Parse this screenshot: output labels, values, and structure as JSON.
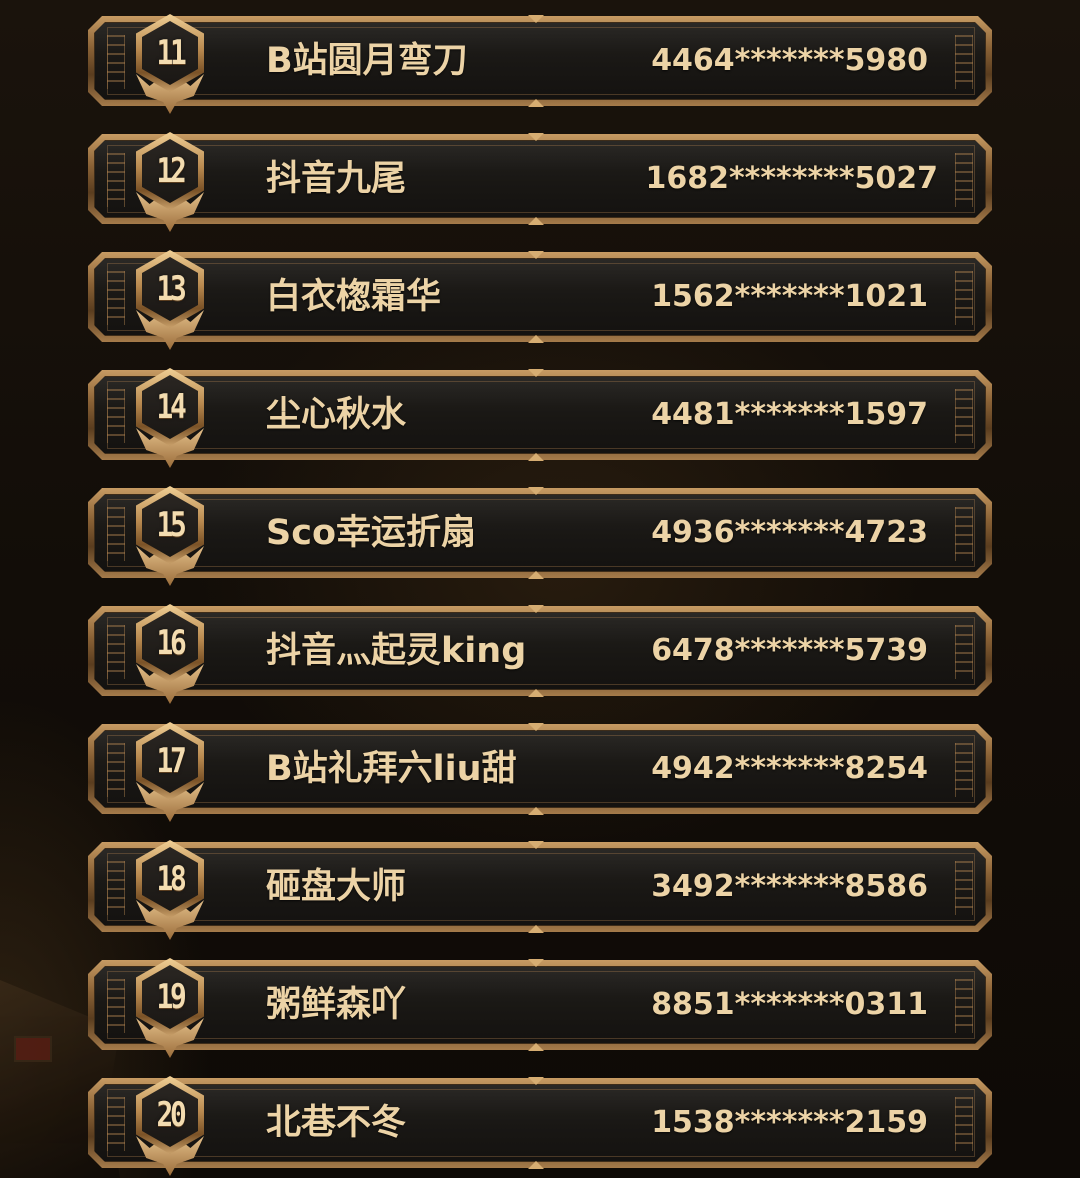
{
  "entries": [
    {
      "rank": "11",
      "name": "B站圆月弯刀",
      "account": "4464*******5980"
    },
    {
      "rank": "12",
      "name": "抖音九尾",
      "account": "1682********5027"
    },
    {
      "rank": "13",
      "name": "白衣楤霜华",
      "account": "1562*******1021"
    },
    {
      "rank": "14",
      "name": "尘心秋水",
      "account": "4481*******1597"
    },
    {
      "rank": "15",
      "name": "Sco幸运折扇",
      "account": "4936*******4723"
    },
    {
      "rank": "16",
      "name": "抖音灬起灵king",
      "account": "6478*******5739"
    },
    {
      "rank": "17",
      "name": "B站礼拜六liu甜",
      "account": "4942*******8254"
    },
    {
      "rank": "18",
      "name": "砸盘大师",
      "account": "3492*******8586"
    },
    {
      "rank": "19",
      "name": "粥鲜森吖",
      "account": "8851*******0311"
    },
    {
      "rank": "20",
      "name": "北巷不冬",
      "account": "1538*******2159"
    }
  ],
  "colors": {
    "text_gold": "#ecd3a6",
    "frame_gold": "#c79b63",
    "plate_dark": "#1b1916",
    "background": "#120d08"
  },
  "icons": {
    "rank_badge": "hexagon-winged-badge-icon"
  }
}
